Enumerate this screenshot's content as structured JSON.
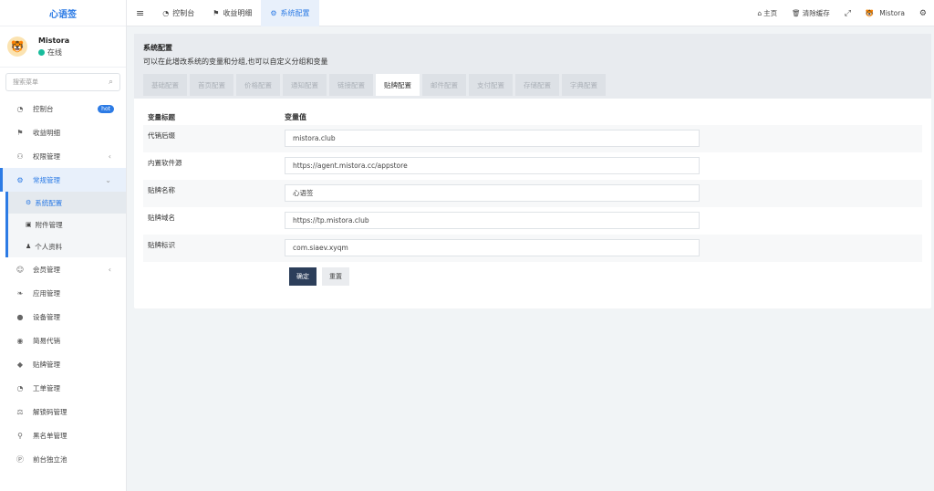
{
  "app": {
    "logo": "心语签"
  },
  "user": {
    "name": "Mistora",
    "status": "在线"
  },
  "search": {
    "placeholder": "搜索菜单"
  },
  "sidebar": {
    "items": [
      {
        "label": "控制台",
        "badge": "hot"
      },
      {
        "label": "收益明细"
      },
      {
        "label": "权限管理",
        "arrow": "‹"
      },
      {
        "label": "常规管理",
        "arrow": "⌄"
      },
      {
        "label": "会员管理",
        "arrow": "‹"
      },
      {
        "label": "应用管理"
      },
      {
        "label": "设备管理"
      },
      {
        "label": "简易代销"
      },
      {
        "label": "贴牌管理"
      },
      {
        "label": "工单管理"
      },
      {
        "label": "解锁码管理"
      },
      {
        "label": "黑名单管理"
      },
      {
        "label": "前台独立池"
      }
    ],
    "sub": [
      {
        "label": "系统配置"
      },
      {
        "label": "附件管理"
      },
      {
        "label": "个人资料"
      }
    ]
  },
  "topbar": {
    "menu_icon": "≡",
    "tabs": [
      {
        "label": "控制台"
      },
      {
        "label": "收益明细"
      },
      {
        "label": "系统配置"
      }
    ],
    "right": {
      "home": "主页",
      "clear": "清除缓存",
      "user": "Mistora"
    }
  },
  "panel": {
    "title": "系统配置",
    "desc": "可以在此增改系统的变量和分组,也可以自定义分组和变量",
    "tabs": [
      "基础配置",
      "首页配置",
      "价格配置",
      "通知配置",
      "链接配置",
      "贴牌配置",
      "邮件配置",
      "支付配置",
      "存储配置",
      "字典配置"
    ],
    "active_tab": "贴牌配置"
  },
  "table": {
    "headers": [
      "变量标题",
      "变量值"
    ],
    "rows": [
      {
        "title": "代销后缀",
        "value": "mistora.club"
      },
      {
        "title": "内置软件源",
        "value": "https://agent.mistora.cc/appstore"
      },
      {
        "title": "贴牌名称",
        "value": "心语签"
      },
      {
        "title": "贴牌域名",
        "value": "https://tp.mistora.club"
      },
      {
        "title": "贴牌标识",
        "value": "com.siaev.xyqm"
      }
    ]
  },
  "buttons": {
    "ok": "确定",
    "reset": "重置"
  },
  "colors": {
    "accent": "#2c7be5",
    "online": "#18bc9c",
    "primary_btn": "#2c3e5a"
  }
}
